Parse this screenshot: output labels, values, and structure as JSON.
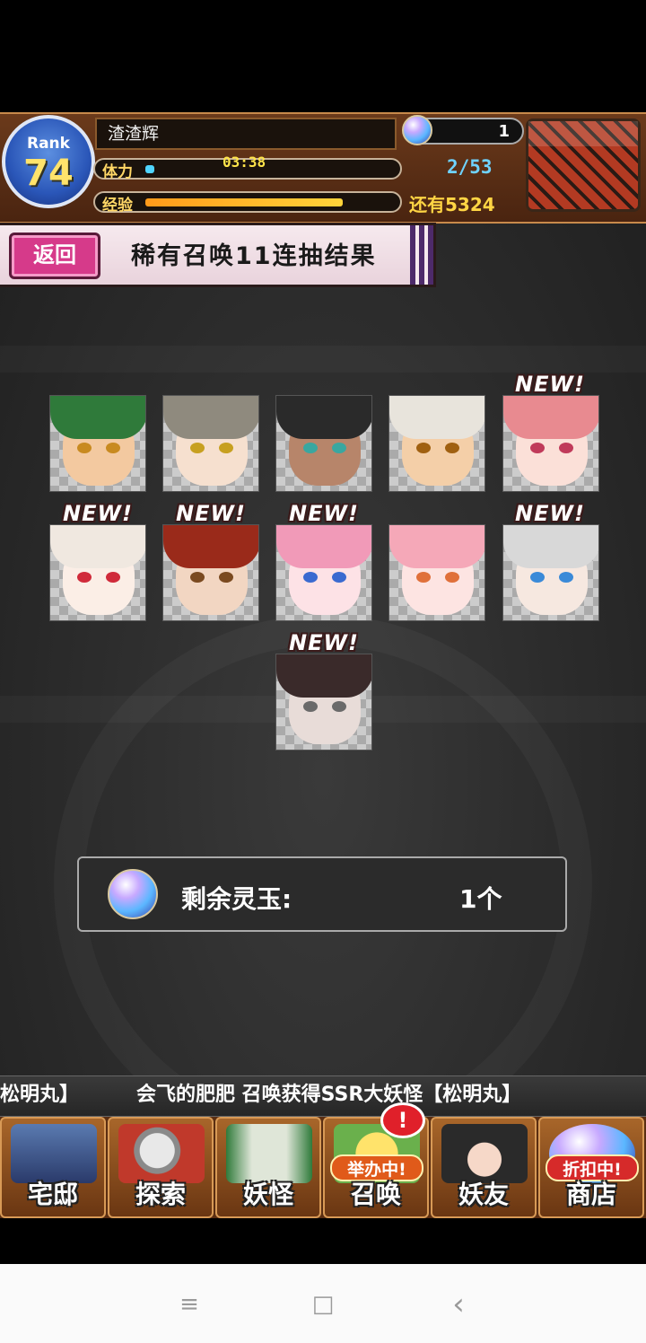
{
  "player": {
    "rank_label": "Rank",
    "rank": "74",
    "name": "渣渣辉",
    "stamina_label": "体力",
    "stamina_timer": "03:38",
    "stamina_value": "2/53",
    "exp_label": "经验",
    "exp_remaining": "还有5324",
    "gems": "1"
  },
  "header": {
    "back_label": "返回",
    "title": "稀有召唤11连抽结果"
  },
  "results": {
    "new_label": "NEW!"
  },
  "remaining": {
    "label": "剩余灵玉:",
    "value": "1个"
  },
  "ticker": {
    "prefix": "松明丸】",
    "message": "会飞的肥肥 召唤获得SSR大妖怪【松明丸】"
  },
  "nav": {
    "items": [
      {
        "label": "宅邸"
      },
      {
        "label": "探索"
      },
      {
        "label": "妖怪"
      },
      {
        "label": "召唤",
        "badge": "举办中!"
      },
      {
        "label": "妖友"
      },
      {
        "label": "商店",
        "badge": "折扣中!"
      }
    ],
    "alert": "!"
  },
  "system_nav": {
    "menu": "≡",
    "home": "□",
    "back": "‹"
  }
}
